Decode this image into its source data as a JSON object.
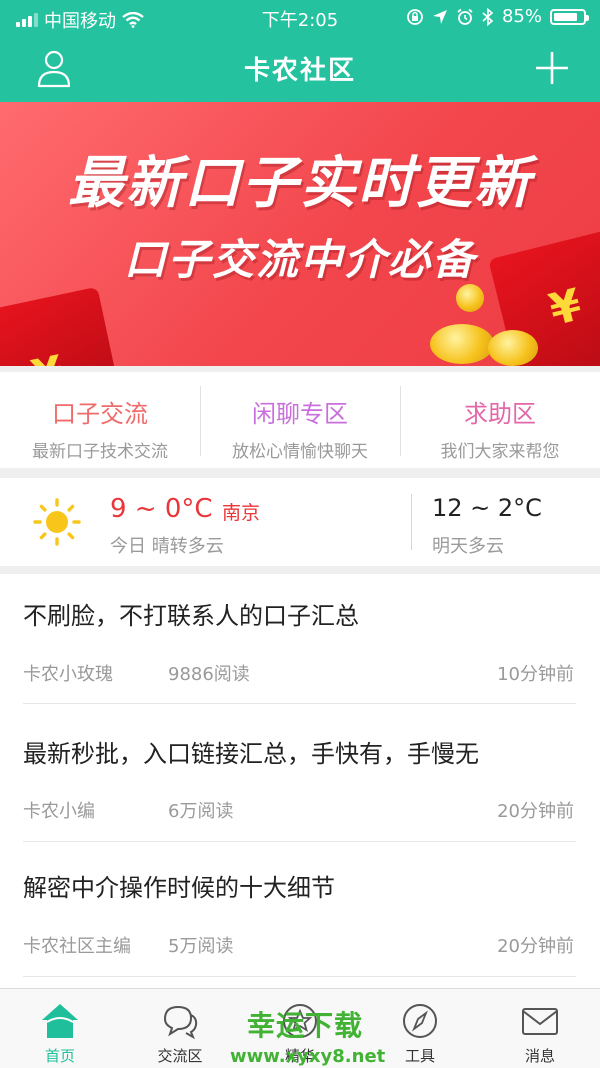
{
  "status_bar": {
    "carrier": "中国移动",
    "time": "下午2:05",
    "battery": "85%",
    "battery_level": 0.85
  },
  "header": {
    "title": "卡农社区",
    "left_icon": "user-icon",
    "right_icon": "plus-icon"
  },
  "banner": {
    "line1": "最新口子实时更新",
    "line2": "口子交流中介必备"
  },
  "categories": [
    {
      "title": "口子交流",
      "subtitle": "最新口子技术交流",
      "color": "#ef6b6b"
    },
    {
      "title": "闲聊专区",
      "subtitle": "放松心情愉快聊天",
      "color": "#c96fdc"
    },
    {
      "title": "求助区",
      "subtitle": "我们大家来帮您",
      "color": "#e268a8"
    }
  ],
  "weather": {
    "today_temp": "9 ~ 0°C",
    "city": "南京",
    "today_desc": "今日 晴转多云",
    "tomorrow_temp": "12 ~ 2°C",
    "tomorrow_desc": "明天多云",
    "icon": "sun-icon"
  },
  "articles": [
    {
      "title": "不刷脸，不打联系人的口子汇总",
      "author": "卡农小玫瑰",
      "reads": "9886阅读",
      "time": "10分钟前"
    },
    {
      "title": "最新秒批，入口链接汇总，手快有，手慢无",
      "author": "卡农小编",
      "reads": "6万阅读",
      "time": "20分钟前"
    },
    {
      "title": "解密中介操作时候的十大细节",
      "author": "卡农社区主编",
      "reads": "5万阅读",
      "time": "20分钟前"
    }
  ],
  "tabbar": [
    {
      "label": "首页",
      "icon": "home-icon",
      "active": true
    },
    {
      "label": "交流区",
      "icon": "chat-bubbles-icon",
      "active": false
    },
    {
      "label": "精华",
      "icon": "star-badge-icon",
      "active": false
    },
    {
      "label": "工具",
      "icon": "compass-icon",
      "active": false
    },
    {
      "label": "消息",
      "icon": "mail-icon",
      "active": false
    }
  ],
  "watermark": {
    "line1": "幸运下载",
    "line2": "www.xyxy8.net"
  },
  "colors": {
    "primary": "#25c2a0",
    "banner_red": "#f2464c",
    "accent_red": "#e8363a",
    "tab_active": "#1fbf9c"
  }
}
